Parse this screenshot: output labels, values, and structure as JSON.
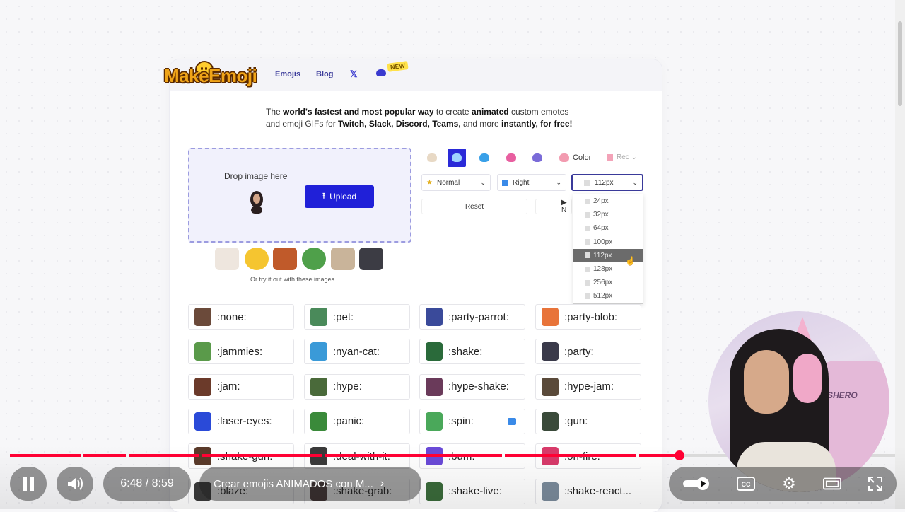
{
  "site": {
    "logo": "MakeEmoji",
    "nav": {
      "emojis": "Emojis",
      "blog": "Blog",
      "x": "X",
      "new_badge": "NEW"
    },
    "tagline": {
      "p1": "The ",
      "b1": "world's fastest and most popular way",
      "p2": " to create ",
      "b2": "animated",
      "p3": " custom emotes and emoji GIFs for ",
      "b3": "Twitch, Slack, Discord, Teams,",
      "p4": " and more ",
      "b4": "instantly, for free!"
    },
    "upload": {
      "drop_label": "Drop image here",
      "button_label": "Upload",
      "samples_caption": "Or try it out with these images"
    },
    "controls": {
      "color_label": "Color",
      "rec_label": "Rec",
      "speed_value": "Normal",
      "direction_value": "Right",
      "size_value": "112px",
      "reset_label": "Reset",
      "play_label": "▶ N"
    },
    "size_options": [
      "24px",
      "32px",
      "64px",
      "100px",
      "112px",
      "128px",
      "256px",
      "512px"
    ],
    "size_highlighted": "112px",
    "emojis": [
      ":none:",
      ":pet:",
      ":party-parrot:",
      ":party-blob:",
      ":jammies:",
      ":nyan-cat:",
      ":shake:",
      ":party:",
      ":jam:",
      ":hype:",
      ":hype-shake:",
      ":hype-jam:",
      ":laser-eyes:",
      ":panic:",
      ":spin:",
      ":gun:",
      ":shake-gun:",
      ":deal-with-it:",
      ":bum:",
      ":on-fire:",
      ":blaze:",
      ":shake-grab:",
      ":shake-live:",
      ":shake-react..."
    ]
  },
  "player": {
    "time": "6:48 / 8:59",
    "chapter": "Crear emojis ANIMADOS con M...",
    "progress_fraction": 0.757,
    "webcam_chair_text": "SHERO"
  },
  "colors": {
    "accent": "#2020d8",
    "progress": "#ff0033",
    "dropzone_border": "#9c9ce0"
  }
}
